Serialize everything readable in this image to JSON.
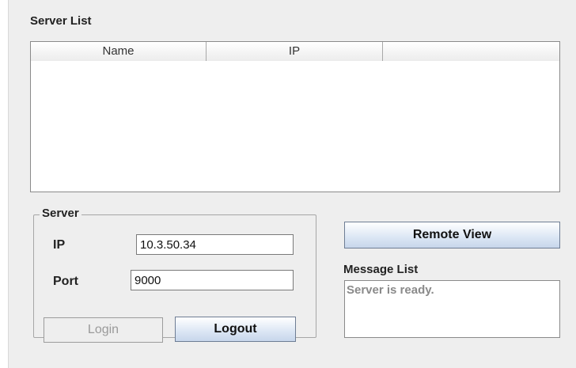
{
  "server_list": {
    "title": "Server List",
    "columns": [
      "Name",
      "IP",
      ""
    ],
    "rows": []
  },
  "server": {
    "legend": "Server",
    "ip_label": "IP",
    "ip_value": "10.3.50.34",
    "port_label": "Port",
    "port_value": "9000",
    "login_label": "Login",
    "logout_label": "Logout"
  },
  "remote_view_label": "Remote View",
  "message_list": {
    "title": "Message List",
    "text": "Server is ready."
  }
}
